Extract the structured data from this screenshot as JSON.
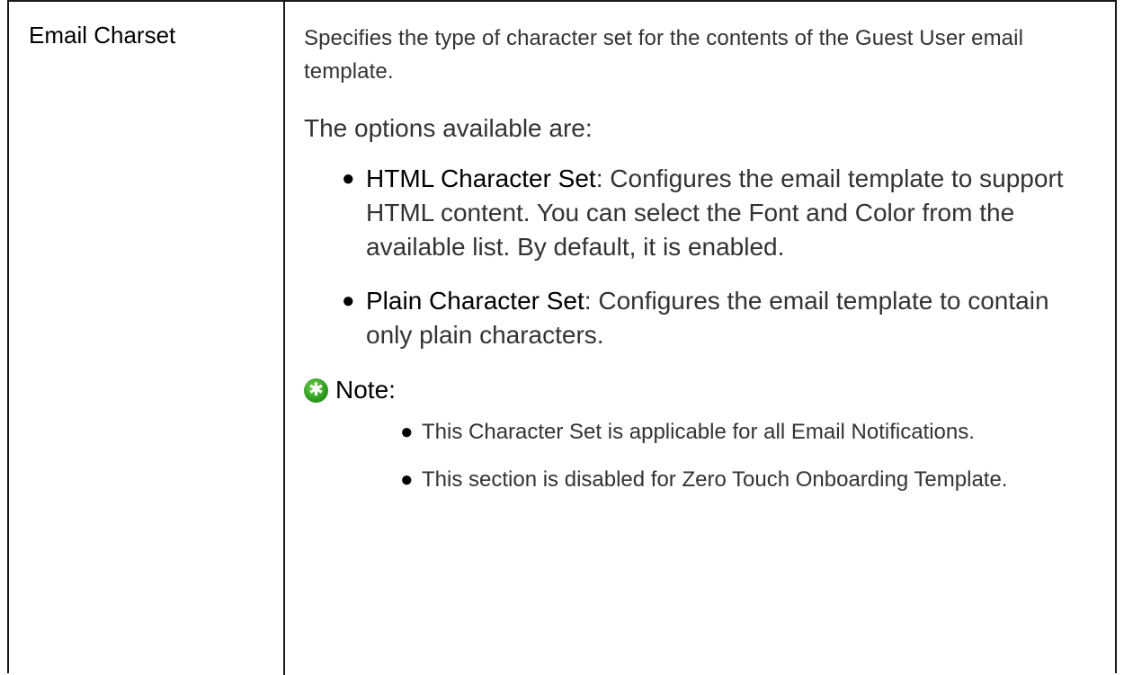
{
  "row": {
    "term": "Email Charset",
    "description": "Specifies the type of character set for the contents of the Guest User email template.",
    "options_intro": "The options available are:",
    "options": [
      {
        "name": "HTML Character Set",
        "text": ": Configures the email template to support HTML content. You can select the Font and Color from the available list. By default, it is enabled."
      },
      {
        "name": "Plain Character Set",
        "text": ": Configures the email template to contain only plain characters."
      }
    ],
    "note": {
      "label": "Note:",
      "icon": "green-star-note-icon",
      "items": [
        "This Character Set is applicable for all Email Notifications.",
        "This section is disabled for Zero Touch Onboarding Template."
      ]
    }
  }
}
